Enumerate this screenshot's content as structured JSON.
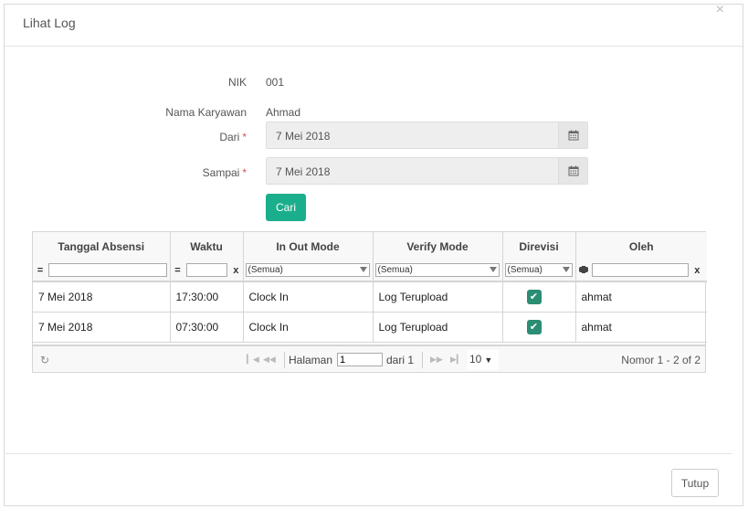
{
  "dialog": {
    "title": "Lihat Log",
    "close_symbol": "×"
  },
  "form": {
    "nik": {
      "label": "NIK",
      "value": "001"
    },
    "nama": {
      "label": "Nama Karyawan",
      "value": "Ahmad"
    },
    "dari": {
      "label": "Dari",
      "required_mark": "*",
      "value": "7 Mei 2018"
    },
    "sampai": {
      "label": "Sampai",
      "required_mark": "*",
      "value": "7 Mei 2018"
    },
    "search_button": "Cari"
  },
  "grid": {
    "columns": [
      "Tanggal Absensi",
      "Waktu",
      "In Out Mode",
      "Verify Mode",
      "Direvisi",
      "Oleh"
    ],
    "filter": {
      "eq_symbol": "=",
      "clear_symbol": "x",
      "select_default": "(Semua)"
    },
    "rows": [
      {
        "tanggal": "7 Mei 2018",
        "waktu": "17:30:00",
        "in_out": "Clock In",
        "verify": "Log Terupload",
        "direvisi": true,
        "oleh": "ahmat"
      },
      {
        "tanggal": "7 Mei 2018",
        "waktu": "07:30:00",
        "in_out": "Clock In",
        "verify": "Log Terupload",
        "direvisi": true,
        "oleh": "ahmat"
      }
    ],
    "pager": {
      "page_label": "Halaman",
      "page_value": "1",
      "of_label": "dari 1",
      "rows_per_page": "10",
      "record_info": "Nomor 1 - 2 of 2"
    }
  },
  "footer": {
    "close_button": "Tutup"
  },
  "colors": {
    "primary": "#1aae8c",
    "checkbox": "#2a8d74",
    "required": "#d9534f"
  }
}
